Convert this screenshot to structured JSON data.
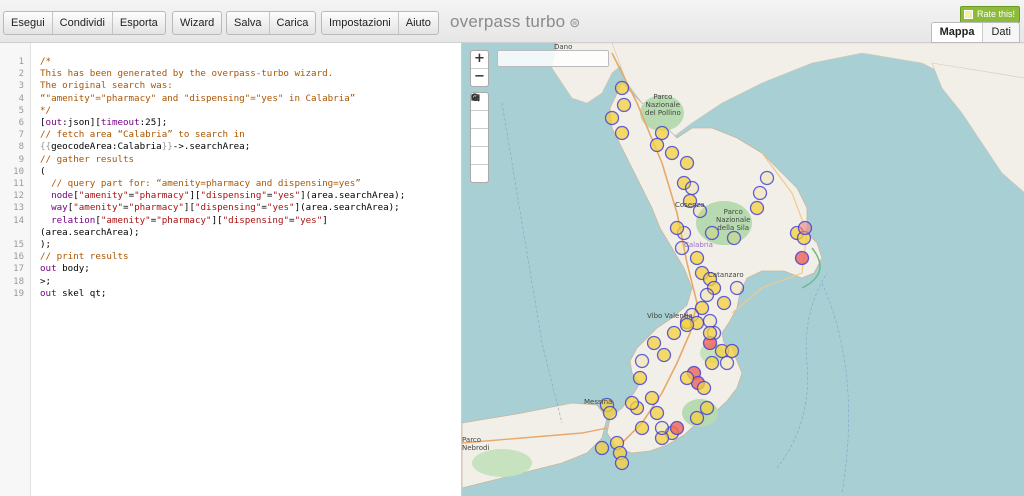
{
  "toolbar": {
    "group1": [
      "Esegui",
      "Condividi",
      "Esporta"
    ],
    "group2": [
      "Wizard"
    ],
    "group3": [
      "Salva",
      "Carica"
    ],
    "group4": [
      "Impostazioni",
      "Aiuto"
    ]
  },
  "app": {
    "title": "overpass turbo",
    "logo_glyph": "⊜"
  },
  "rate": {
    "label": "Rate this!"
  },
  "view_tabs": {
    "map": "Mappa",
    "data": "Dati",
    "active": "map"
  },
  "editor": {
    "line_numbers": [
      "1",
      "2",
      "3",
      "4",
      "5",
      "6",
      "7",
      "8",
      "9",
      "10",
      "11",
      "12",
      "13",
      "14",
      "",
      "15",
      "16",
      "17",
      "18",
      "19"
    ],
    "lines": [
      "/*",
      "This has been generated by the overpass-turbo wizard.",
      "The original search was:",
      "“\"amenity\"=\"pharmacy\" and \"dispensing\"=\"yes\" in Calabria”",
      "*/",
      "[out:json][timeout:25];",
      "// fetch area “Calabria” to search in",
      "{{geocodeArea:Calabria}}->.searchArea;",
      "// gather results",
      "(",
      "  // query part for: “amenity=pharmacy and dispensing=yes”",
      "  node[\"amenity\"=\"pharmacy\"][\"dispensing\"=\"yes\"](area.searchArea);",
      "  way[\"amenity\"=\"pharmacy\"][\"dispensing\"=\"yes\"](area.searchArea);",
      "  relation[\"amenity\"=\"pharmacy\"][\"dispensing\"=\"yes\"]",
      "(area.searchArea);",
      ");",
      "// print results",
      "out body;",
      ">;",
      "out skel qt;"
    ]
  },
  "map": {
    "zoom_in": "+",
    "zoom_out": "−",
    "tool_icons": [
      "search-icon",
      "locate-icon",
      "image-icon",
      "fit-icon",
      "clear-icon"
    ],
    "labels": {
      "dano": "Dano",
      "parco_pollino": "Parco\nNazionale\ndel Pollino",
      "cosenza": "Cosenza",
      "parco_sila": "Parco\nNazionale\ndella Sila",
      "calabria": "Calabria",
      "catanzaro": "Catanzaro",
      "vibo": "Vibo Valentia",
      "messina": "Messina",
      "nebrodi": "Parco\nNebrodi"
    },
    "colors": {
      "sea": "#a8cfd4",
      "land": "#f2efe9",
      "forest": "#b8dab0",
      "marker_fill": "#f5d23c",
      "marker_stroke": "#3b3bd6",
      "marker_red": "#ef6a5f"
    }
  }
}
